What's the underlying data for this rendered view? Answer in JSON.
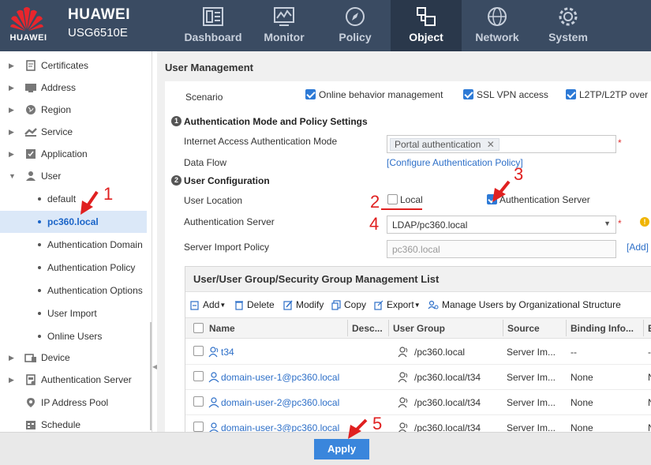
{
  "header": {
    "logo_text": "HUAWEI",
    "brand": "HUAWEI",
    "model": "USG6510E",
    "nav": [
      {
        "label": "Dashboard",
        "icon": "dashboard-icon"
      },
      {
        "label": "Monitor",
        "icon": "monitor-icon"
      },
      {
        "label": "Policy",
        "icon": "policy-compass-icon"
      },
      {
        "label": "Object",
        "icon": "object-icon",
        "active": true
      },
      {
        "label": "Network",
        "icon": "network-globe-icon"
      },
      {
        "label": "System",
        "icon": "system-gear-icon"
      }
    ]
  },
  "sidebar": {
    "items": [
      {
        "label": "Certificates",
        "icon": "certificate-icon"
      },
      {
        "label": "Address",
        "icon": "address-icon"
      },
      {
        "label": "Region",
        "icon": "region-globe-icon"
      },
      {
        "label": "Service",
        "icon": "service-icon"
      },
      {
        "label": "Application",
        "icon": "application-icon"
      },
      {
        "label": "User",
        "icon": "user-icon"
      },
      {
        "label": "default"
      },
      {
        "label": "pc360.local",
        "selected": true
      },
      {
        "label": "Authentication Domain"
      },
      {
        "label": "Authentication Policy"
      },
      {
        "label": "Authentication Options"
      },
      {
        "label": "User Import"
      },
      {
        "label": "Online Users"
      },
      {
        "label": "Device",
        "icon": "device-icon"
      },
      {
        "label": "Authentication Server",
        "icon": "auth-server-icon"
      },
      {
        "label": "IP Address Pool",
        "icon": "ip-pool-icon"
      },
      {
        "label": "Schedule",
        "icon": "schedule-icon"
      }
    ]
  },
  "main": {
    "title": "User Management",
    "scenario": {
      "label": "Scenario",
      "options": [
        {
          "label": "Online behavior management",
          "checked": true
        },
        {
          "label": "SSL VPN access",
          "checked": true
        },
        {
          "label": "L2TP/L2TP over",
          "checked": true
        }
      ]
    },
    "auth_section": {
      "num": "1",
      "title": "Authentication Mode and Policy Settings",
      "mode_label": "Internet Access Authentication Mode",
      "mode_value": "Portal authentication",
      "data_flow_label": "Data Flow",
      "data_flow_link": "[Configure Authentication Policy]"
    },
    "user_config": {
      "num": "2",
      "title": "User Configuration",
      "location_label": "User Location",
      "local_label": "Local",
      "local_checked": false,
      "server_label": "Authentication Server",
      "server_checked": true,
      "auth_server_label": "Authentication Server",
      "auth_server_value": "LDAP/pc360.local",
      "import_policy_label": "Server Import Policy",
      "import_policy_placeholder": "pc360.local",
      "add_link": "[Add]",
      "required_mark": "*",
      "warn_mark": "!"
    },
    "grid": {
      "title": "User/User Group/Security Group Management List",
      "toolbar": [
        {
          "label": "Add",
          "icon": "add-icon"
        },
        {
          "label": "Delete",
          "icon": "delete-icon"
        },
        {
          "label": "Modify",
          "icon": "modify-icon"
        },
        {
          "label": "Copy",
          "icon": "copy-icon"
        },
        {
          "label": "Export",
          "icon": "export-icon"
        },
        {
          "label": "Manage Users by Organizational Structure",
          "icon": "manage-users-icon"
        }
      ],
      "columns": [
        "Name",
        "Desc...",
        "User Group",
        "Source",
        "Binding Info...",
        "E"
      ],
      "rows": [
        {
          "name": "t34",
          "group": "/pc360.local",
          "source": "Server Im...",
          "binding": "--",
          "extra": "-"
        },
        {
          "name": "domain-user-1@pc360.local",
          "group": "/pc360.local/t34",
          "source": "Server Im...",
          "binding": "None",
          "extra": "N"
        },
        {
          "name": "domain-user-2@pc360.local",
          "group": "/pc360.local/t34",
          "source": "Server Im...",
          "binding": "None",
          "extra": "N"
        },
        {
          "name": "domain-user-3@pc360.local",
          "group": "/pc360.local/t34",
          "source": "Server Im...",
          "binding": "None",
          "extra": "N"
        }
      ]
    }
  },
  "footer": {
    "apply_label": "Apply"
  },
  "annotations": [
    "1",
    "2",
    "3",
    "4",
    "5"
  ],
  "colors": {
    "header": "#3a4b62",
    "accent": "#2d7ad6",
    "annotation": "#e02020",
    "link": "#2d6fc8"
  }
}
